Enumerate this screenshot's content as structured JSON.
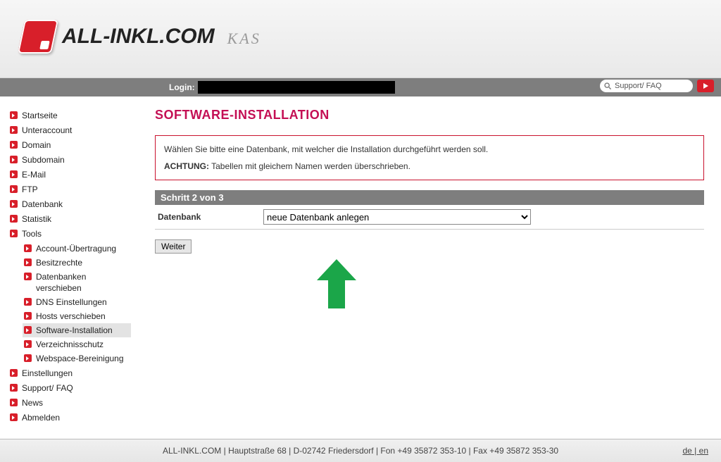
{
  "brand": {
    "name": "ALL-INKL.COM",
    "suffix": "KAS"
  },
  "loginbar": {
    "label": "Login:",
    "support_placeholder": "Support/ FAQ"
  },
  "sidebar": {
    "items": [
      {
        "label": "Startseite"
      },
      {
        "label": "Unteraccount"
      },
      {
        "label": "Domain"
      },
      {
        "label": "Subdomain"
      },
      {
        "label": "E-Mail"
      },
      {
        "label": "FTP"
      },
      {
        "label": "Datenbank"
      },
      {
        "label": "Statistik"
      },
      {
        "label": "Tools"
      },
      {
        "label": "Einstellungen"
      },
      {
        "label": "Support/ FAQ"
      },
      {
        "label": "News"
      },
      {
        "label": "Abmelden"
      }
    ],
    "tools_sub": [
      {
        "label": "Account-Übertragung"
      },
      {
        "label": "Besitzrechte"
      },
      {
        "label": "Datenbanken verschieben"
      },
      {
        "label": "DNS Einstellungen"
      },
      {
        "label": "Hosts verschieben"
      },
      {
        "label": "Software-Installation"
      },
      {
        "label": "Verzeichnisschutz"
      },
      {
        "label": "Webspace-Bereinigung"
      }
    ]
  },
  "page": {
    "title": "SOFTWARE-INSTALLATION",
    "notice_line1": "Wählen Sie bitte eine Datenbank, mit welcher die Installation durchgeführt werden soll.",
    "notice_strong": "ACHTUNG:",
    "notice_line2": " Tabellen mit gleichem Namen werden überschrieben.",
    "step_header": "Schritt 2 von 3",
    "db_label": "Datenbank",
    "db_selected": "neue Datenbank anlegen",
    "submit": "Weiter"
  },
  "footer": {
    "text": "ALL-INKL.COM | Hauptstraße 68 | D-02742 Friedersdorf | Fon +49 35872 353-10 | Fax +49 35872 353-30",
    "lang_de": "de",
    "lang_sep": " | ",
    "lang_en": "en"
  }
}
